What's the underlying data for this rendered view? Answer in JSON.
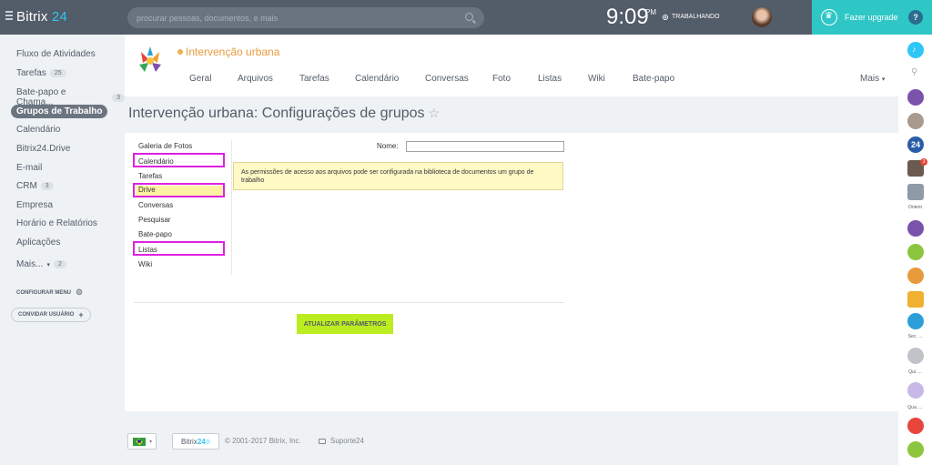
{
  "header": {
    "logo_main": "Bitrix",
    "logo_accent": " 24",
    "search_placeholder": "procurar pessoas, documentos, e mais",
    "time": "9:09",
    "time_suffix": "PM",
    "work_status": "TRABALHANDO",
    "upgrade_label": "Fazer upgrade",
    "help_label": "?"
  },
  "sidebar": {
    "items": [
      {
        "label": "Fluxo de Atividades"
      },
      {
        "label": "Tarefas",
        "count": "25"
      },
      {
        "label": "Bate-papo e Chama...",
        "count": "3"
      },
      {
        "label": "Grupos de Trabalho"
      },
      {
        "label": "Calendário"
      },
      {
        "label": "Bitrix24.Drive"
      },
      {
        "label": "E-mail"
      },
      {
        "label": "CRM",
        "count": "3"
      },
      {
        "label": "Empresa"
      },
      {
        "label": "Horário e Relatórios"
      },
      {
        "label": "Aplicações"
      },
      {
        "label": "Mais...",
        "count": "2"
      }
    ],
    "configure_label": "CONFIGURAR MENU",
    "invite_label": "CONVIDAR USUÁRIO"
  },
  "group": {
    "title": "Intervenção urbana",
    "tabs": [
      "Geral",
      "Arquivos",
      "Tarefas",
      "Calendário",
      "Conversas",
      "Foto",
      "Listas",
      "Wiki",
      "Bate-papo"
    ],
    "more_label": "Mais"
  },
  "page": {
    "title": "Intervenção urbana: Configurações de grupos"
  },
  "settings": {
    "items": [
      "Galeria de Fotos",
      "Calendário",
      "Tarefas",
      "Drive",
      "Conversas",
      "Pesquisar",
      "Bate-papo",
      "Listas",
      "Wiki"
    ],
    "name_label": "Nome:",
    "name_value": "",
    "notice": "As permissões de acesso aos arquivos pode ser configurada na biblioteca de documentos um grupo de trabalho",
    "save_label": "ATUALIZAR PARÂMETROS"
  },
  "footer": {
    "logo_main": "Bitrix",
    "logo_accent": "24",
    "copyright": "© 2001-2017 Bitrix, Inc.",
    "support": "Suporte24"
  },
  "rightbar": {
    "badge_count": "3",
    "label_ontem": "Ontem",
    "label_sec": "Sec. ...",
    "label_qui": "Qui. ...",
    "label_qua": "Qua. ..."
  },
  "colors": {
    "header_bg": "#535c69",
    "accent": "#2fc6f6",
    "upgrade_bg": "#2fc7c6",
    "save_button": "#bbed21",
    "group_title": "#e89b3c",
    "highlight": "#e020e0"
  }
}
